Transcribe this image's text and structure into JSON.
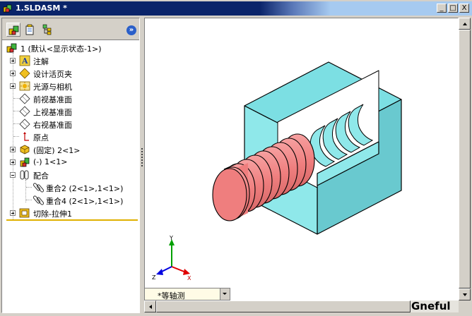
{
  "window": {
    "title": "1.SLDASM *",
    "buttons": {
      "minimize": "_",
      "maximize": "□",
      "close": "X"
    }
  },
  "panel_tabs": [
    {
      "name": "featuremanager-tab",
      "active": true
    },
    {
      "name": "propertymanager-tab",
      "active": false
    },
    {
      "name": "configurationmanager-tab",
      "active": false
    }
  ],
  "panel_expand": "»",
  "tree": {
    "root": "1 (默认<显示状态-1>)",
    "annotations": "注解",
    "design_binder": "设计活页夹",
    "lights_cameras": "光源与相机",
    "front_plane": "前视基准面",
    "top_plane": "上视基准面",
    "right_plane": "右视基准面",
    "origin": "原点",
    "part_fixed": "(固定) 2<1>",
    "part_float": "(-) 1<1>",
    "mates": "配合",
    "mate_1": "重合2 (2<1>,1<1>)",
    "mate_2": "重合4 (2<1>,1<1>)",
    "cut_extrude": "切除-拉伸1"
  },
  "viewport": {
    "model_colors": {
      "block": "#8fe8ea",
      "block_top": "#7cdfe3",
      "screw": "#ef7e7e"
    },
    "triad": {
      "x": "X",
      "y": "Y",
      "z": "Z"
    },
    "view_orientation": "*等轴测"
  },
  "watermark": "Gneful"
}
